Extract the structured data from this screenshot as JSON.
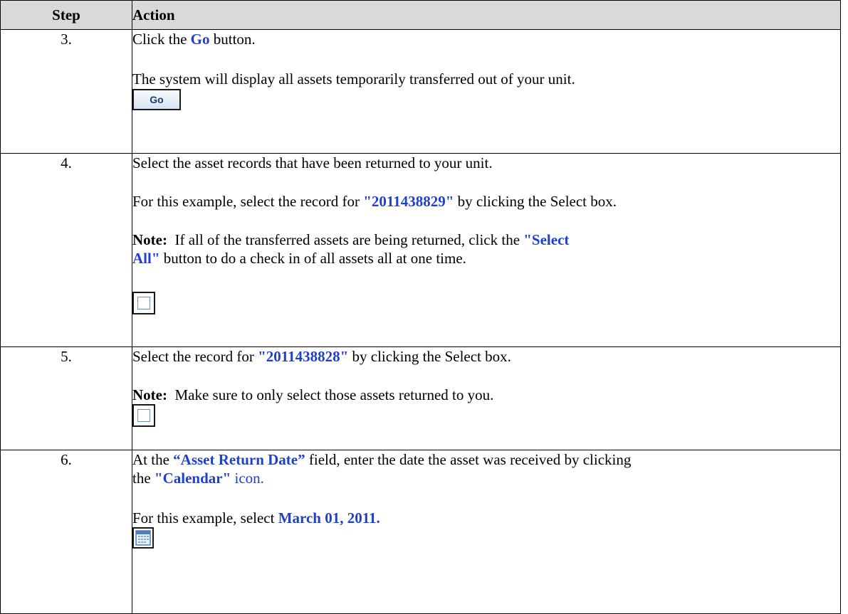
{
  "headers": {
    "step": "Step",
    "action": "Action"
  },
  "rows": [
    {
      "step": "3.",
      "line1_pre": "Click the ",
      "line1_hl": "Go",
      "line1_post": " button.",
      "line2": "The system will display all assets temporarily transferred out of your unit.",
      "button_label": "Go"
    },
    {
      "step": "4.",
      "line1": "Select the asset records that have been returned to your unit.",
      "line2_pre": "For this example, select the record for ",
      "line2_hl": "\"2011438829\"",
      "line2_post": " by clicking the Select box.",
      "note_label": "Note:",
      "note_pre": "  If all of the transferred assets are being returned, click the ",
      "note_hl1": "\"Select",
      "note_hl2": "All\"",
      "note_post": " button to do a check in of all assets all at one time."
    },
    {
      "step": "5.",
      "line1_pre": "Select the record for ",
      "line1_hl": "\"2011438828\"",
      "line1_post": " by clicking the Select box.",
      "note_label": "Note:",
      "note_text": "  Make sure to only select those assets returned to you."
    },
    {
      "step": "6.",
      "line1_pre": "At the ",
      "line1_hl": "“Asset Return Date”",
      "line1_post": " field, enter the date the asset was received by clicking",
      "line2_pre": "the ",
      "line2_hl": "\"Calendar\"",
      "line2_post": " icon.",
      "line3_pre": "For this example, select ",
      "line3_hl": "March 01, 2011."
    }
  ],
  "icons": {
    "checkbox": "checkbox-icon",
    "calendar": "calendar-icon"
  },
  "colors": {
    "highlight": "#1f3fd0",
    "header_bg": "#d9d9d9"
  }
}
